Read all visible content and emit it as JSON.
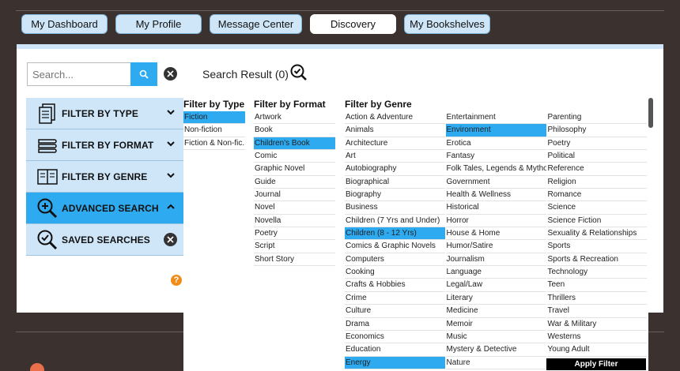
{
  "tabs": [
    {
      "label": "My Dashboard",
      "active": false
    },
    {
      "label": "My Profile",
      "active": false
    },
    {
      "label": "Message Center",
      "active": false
    },
    {
      "label": "Discovery",
      "active": true
    },
    {
      "label": "My Bookshelves",
      "active": false
    }
  ],
  "search": {
    "placeholder": "Search...",
    "result_label": "Search Result (0)"
  },
  "sidebar": [
    {
      "label": "FILTER BY TYPE"
    },
    {
      "label": "FILTER BY FORMAT"
    },
    {
      "label": "FILTER BY GENRE"
    },
    {
      "label": "ADVANCED SEARCH"
    },
    {
      "label": "SAVED SEARCHES"
    }
  ],
  "help_label": "?",
  "filters": {
    "type": {
      "title": "Filter by Type",
      "options": [
        {
          "label": "Fiction",
          "selected": true
        },
        {
          "label": "Non-fiction",
          "selected": false
        },
        {
          "label": "Fiction & Non-fic...",
          "selected": false
        }
      ]
    },
    "format": {
      "title": "Filter by Format",
      "options": [
        {
          "label": "Artwork",
          "selected": false
        },
        {
          "label": "Book",
          "selected": false
        },
        {
          "label": "Children's Book",
          "selected": true
        },
        {
          "label": "Comic",
          "selected": false
        },
        {
          "label": "Graphic Novel",
          "selected": false
        },
        {
          "label": "Guide",
          "selected": false
        },
        {
          "label": "Journal",
          "selected": false
        },
        {
          "label": "Novel",
          "selected": false
        },
        {
          "label": "Novella",
          "selected": false
        },
        {
          "label": "Poetry",
          "selected": false
        },
        {
          "label": "Script",
          "selected": false
        },
        {
          "label": "Short Story",
          "selected": false
        }
      ]
    },
    "genre": {
      "title": "Filter by Genre",
      "columns": [
        [
          {
            "label": "Action & Adventure",
            "selected": false
          },
          {
            "label": "Animals",
            "selected": false
          },
          {
            "label": "Architecture",
            "selected": false
          },
          {
            "label": "Art",
            "selected": false
          },
          {
            "label": "Autobiography",
            "selected": false
          },
          {
            "label": "Biographical",
            "selected": false
          },
          {
            "label": "Biography",
            "selected": false
          },
          {
            "label": "Business",
            "selected": false
          },
          {
            "label": "Children (7 Yrs and Under)",
            "selected": false
          },
          {
            "label": "Children (8 - 12 Yrs)",
            "selected": true
          },
          {
            "label": "Comics & Graphic Novels",
            "selected": false
          },
          {
            "label": "Computers",
            "selected": false
          },
          {
            "label": "Cooking",
            "selected": false
          },
          {
            "label": "Crafts & Hobbies",
            "selected": false
          },
          {
            "label": "Crime",
            "selected": false
          },
          {
            "label": "Culture",
            "selected": false
          },
          {
            "label": "Drama",
            "selected": false
          },
          {
            "label": "Economics",
            "selected": false
          },
          {
            "label": "Education",
            "selected": false
          },
          {
            "label": "Energy",
            "selected": true
          }
        ],
        [
          {
            "label": "Entertainment",
            "selected": false
          },
          {
            "label": "Environment",
            "selected": true
          },
          {
            "label": "Erotica",
            "selected": false
          },
          {
            "label": "Fantasy",
            "selected": false
          },
          {
            "label": "Folk Tales, Legends & Mythol...",
            "selected": false
          },
          {
            "label": "Government",
            "selected": false
          },
          {
            "label": "Health & Wellness",
            "selected": false
          },
          {
            "label": "Historical",
            "selected": false
          },
          {
            "label": "Horror",
            "selected": false
          },
          {
            "label": "House & Home",
            "selected": false
          },
          {
            "label": "Humor/Satire",
            "selected": false
          },
          {
            "label": "Journalism",
            "selected": false
          },
          {
            "label": "Language",
            "selected": false
          },
          {
            "label": "Legal/Law",
            "selected": false
          },
          {
            "label": "Literary",
            "selected": false
          },
          {
            "label": "Medicine",
            "selected": false
          },
          {
            "label": "Memoir",
            "selected": false
          },
          {
            "label": "Music",
            "selected": false
          },
          {
            "label": "Mystery & Detective",
            "selected": false
          },
          {
            "label": "Nature",
            "selected": false
          }
        ],
        [
          {
            "label": "Parenting",
            "selected": false
          },
          {
            "label": "Philosophy",
            "selected": false
          },
          {
            "label": "Poetry",
            "selected": false
          },
          {
            "label": "Political",
            "selected": false
          },
          {
            "label": "Reference",
            "selected": false
          },
          {
            "label": "Religion",
            "selected": false
          },
          {
            "label": "Romance",
            "selected": false
          },
          {
            "label": "Science",
            "selected": false
          },
          {
            "label": "Science Fiction",
            "selected": false
          },
          {
            "label": "Sexuality & Relationships",
            "selected": false
          },
          {
            "label": "Sports",
            "selected": false
          },
          {
            "label": "Sports & Recreation",
            "selected": false
          },
          {
            "label": "Technology",
            "selected": false
          },
          {
            "label": "Teen",
            "selected": false
          },
          {
            "label": "Thrillers",
            "selected": false
          },
          {
            "label": "Travel",
            "selected": false
          },
          {
            "label": "War & Military",
            "selected": false
          },
          {
            "label": "Westerns",
            "selected": false
          },
          {
            "label": "Young Adult",
            "selected": false
          }
        ]
      ]
    },
    "apply_label": "Apply Filter"
  },
  "colors": {
    "accent": "#2eaaf0",
    "tab_bg": "#cfe6f8",
    "background": "#3b312e"
  }
}
